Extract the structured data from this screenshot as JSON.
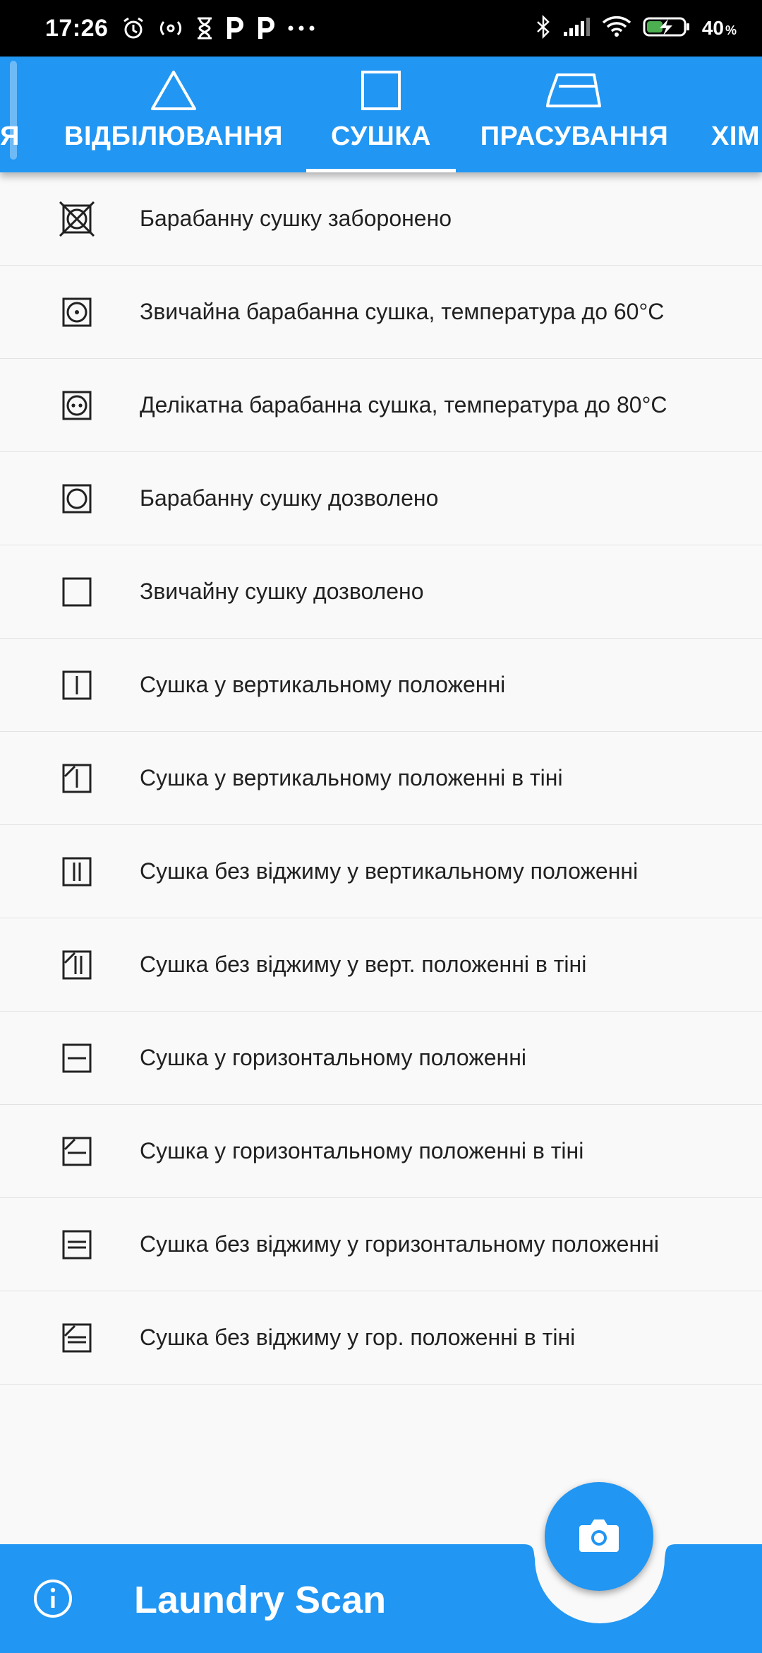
{
  "status_bar": {
    "time": "17:26",
    "battery_percent": "40",
    "percent_sign": "%"
  },
  "tabs": [
    {
      "label": "Я",
      "icon": "partial-tab",
      "active": false
    },
    {
      "label": "ВІДБІЛЮВАННЯ",
      "icon": "triangle-icon",
      "active": false
    },
    {
      "label": "СУШКА",
      "icon": "square-icon",
      "active": true
    },
    {
      "label": "ПРАСУВАННЯ",
      "icon": "iron-icon",
      "active": false
    },
    {
      "label": "ХІМ",
      "icon": "partial-tab",
      "active": false
    }
  ],
  "items": [
    {
      "label": "Барабанну сушку заборонено",
      "icon": "tumble-dry-forbidden-icon"
    },
    {
      "label": "Звичайна барабанна сушка, температура до 60°C",
      "icon": "tumble-dry-low-icon"
    },
    {
      "label": "Делікатна барабанна сушка, температура до 80°C",
      "icon": "tumble-dry-normal-icon"
    },
    {
      "label": "Барабанну сушку дозволено",
      "icon": "tumble-dry-icon"
    },
    {
      "label": "Звичайну сушку дозволено",
      "icon": "dry-icon"
    },
    {
      "label": "Сушка у вертикальному положенні",
      "icon": "line-dry-icon"
    },
    {
      "label": "Сушка у вертикальному положенні в тіні",
      "icon": "line-dry-shade-icon"
    },
    {
      "label": "Сушка без віджиму у вертикальному положенні",
      "icon": "drip-dry-icon"
    },
    {
      "label": "Сушка без віджиму у верт. положенні в тіні",
      "icon": "drip-dry-shade-icon"
    },
    {
      "label": "Сушка у горизонтальному положенні",
      "icon": "flat-dry-icon"
    },
    {
      "label": "Сушка у горизонтальному положенні в тіні",
      "icon": "flat-dry-shade-icon"
    },
    {
      "label": "Сушка без віджиму у горизонтальному положенні",
      "icon": "flat-drip-dry-icon"
    },
    {
      "label": "Сушка без віджиму у гор. положенні в тіні",
      "icon": "flat-drip-dry-shade-icon"
    }
  ],
  "bottom_bar": {
    "title": "Laundry Scan",
    "info_icon": "info-icon",
    "fab_icon": "camera-icon"
  },
  "colors": {
    "primary": "#2196f3",
    "background": "#f9f9f9",
    "text": "#212121",
    "divider": "#e3e3e3"
  }
}
